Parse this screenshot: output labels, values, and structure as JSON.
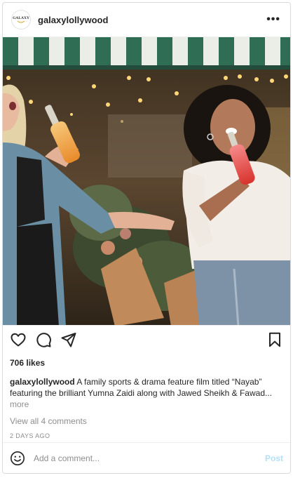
{
  "header": {
    "avatar_text": "GALAXY",
    "username": "galaxylollywood",
    "more_label": "•••"
  },
  "post": {
    "image_description_icon": "photo-image",
    "likes": "706 likes",
    "caption": {
      "username": "galaxylollywood",
      "text": " A family sports & drama feature film titled “Nayab” featuring the brilliant Yumna Zaidi along with Jawed Sheikh & Fawad...",
      "more_label": " more"
    },
    "comments_link": "View all 4 comments",
    "timestamp": "2 DAYS AGO"
  },
  "actions": {
    "like_icon": "heart-icon",
    "comment_icon": "comment-icon",
    "share_icon": "share-icon",
    "save_icon": "bookmark-icon"
  },
  "comment_bar": {
    "emoji_icon": "emoji-icon",
    "placeholder": "Add a comment...",
    "post_label": "Post"
  },
  "colors": {
    "post_button": "#b2dffc",
    "muted_text": "#8e8e8e",
    "text": "#262626"
  }
}
